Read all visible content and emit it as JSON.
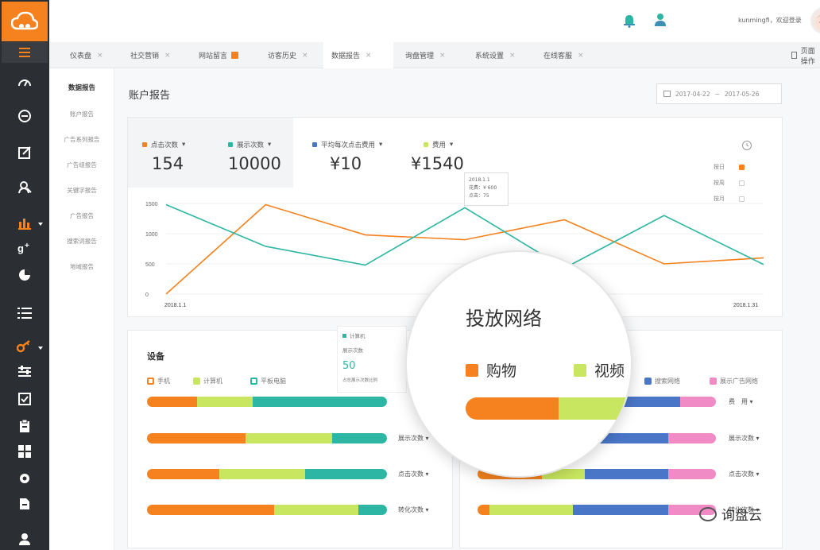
{
  "colors": {
    "orange": "#f5821f",
    "teal": "#2db6a3",
    "blue": "#4a76c8",
    "lime": "#c8e65f",
    "pink": "#f08bc6",
    "sidebar": "#2b2e33"
  },
  "topbar": {
    "user_text": "kunmingfi，欢迎登录"
  },
  "tabs": [
    {
      "label": "仪表盘",
      "close": "×"
    },
    {
      "label": "社交营销",
      "close": "×"
    },
    {
      "label": "网站留言",
      "close": ""
    },
    {
      "label": "访客历史",
      "close": "×"
    },
    {
      "label": "数据报告",
      "close": "×"
    },
    {
      "label": "询盘管理",
      "close": "×"
    },
    {
      "label": "系统设置",
      "close": "×"
    },
    {
      "label": "在线客服",
      "close": "×"
    }
  ],
  "page_op": "页面操作",
  "submenu": {
    "head": "数据报告",
    "items": [
      "账户报告",
      "广告系列报告",
      "广告组报告",
      "关键字报告",
      "广告报告",
      "搜索词报告",
      "地域报告"
    ]
  },
  "main": {
    "title": "账户报告",
    "date_start": "2017-04-22",
    "date_sep": "~",
    "date_end": "2017-05-26"
  },
  "metrics": [
    {
      "label": "点击次数",
      "value": "154",
      "color": "#f5821f"
    },
    {
      "label": "展示次数",
      "value": "10000",
      "color": "#2db6a3"
    },
    {
      "label": "平均每次点击费用",
      "value": "¥10",
      "color": "#4a76c8"
    },
    {
      "label": "费用",
      "value": "¥1540",
      "color": "#c8e65f"
    }
  ],
  "legend_right": [
    {
      "label": "按日",
      "checked": true
    },
    {
      "label": "按周",
      "checked": false
    },
    {
      "label": "按月",
      "checked": false
    }
  ],
  "tooltip": {
    "date": "2018.1.1",
    "line1": "花费：¥ 600",
    "line2": "点击：75"
  },
  "chart_data": {
    "type": "line",
    "x_start_label": "2018.1.1",
    "x_end_label": "2018.1.31",
    "y_ticks": [
      "1500",
      "1000",
      "500",
      "0"
    ],
    "ylim": [
      0,
      1500
    ],
    "series": [
      {
        "name": "点击次数",
        "color": "#f5821f",
        "values": [
          0,
          1480,
          980,
          900,
          1230,
          500,
          600
        ]
      },
      {
        "name": "展示次数",
        "color": "#2db6a3",
        "values": [
          1480,
          790,
          480,
          1430,
          430,
          1300,
          490
        ]
      }
    ]
  },
  "device_card": {
    "title": "设备",
    "legend": [
      {
        "label": "手机",
        "color": "#f5821f"
      },
      {
        "label": "计算机",
        "color": "#c8e65f"
      },
      {
        "label": "平板电脑",
        "color": "#2db6a3"
      }
    ],
    "rows": [
      {
        "label": "",
        "segments": [
          0.21,
          0.23,
          0.56
        ]
      },
      {
        "label": "展示次数",
        "segments": [
          0.41,
          0.36,
          0.23
        ]
      },
      {
        "label": "点击次数",
        "segments": [
          0.3,
          0.36,
          0.34
        ]
      },
      {
        "label": "转化次数",
        "segments": [
          0.53,
          0.35,
          0.12
        ]
      }
    ]
  },
  "mini_tip": {
    "label": "计算机",
    "sub": "展示次数",
    "value": "50",
    "note": "占总展示次数比例"
  },
  "network_card": {
    "title": "投放网络",
    "legend": [
      {
        "label": "购物",
        "color": "#f5821f"
      },
      {
        "label": "视频",
        "color": "#c8e65f"
      },
      {
        "label": "搜索网络",
        "color": "#4a76c8"
      },
      {
        "label": "展示广告网络",
        "color": "#f08bc6"
      }
    ],
    "rows": [
      {
        "label": "费　用",
        "segments": [
          0.3,
          0.25,
          0.3,
          0.15
        ]
      },
      {
        "label": "展示次数",
        "segments": [
          0.2,
          0.3,
          0.3,
          0.2
        ]
      },
      {
        "label": "点击次数",
        "segments": [
          0.27,
          0.18,
          0.35,
          0.2
        ]
      },
      {
        "label": "转化次数",
        "segments": [
          0.05,
          0.35,
          0.4,
          0.2
        ]
      }
    ]
  },
  "watermark": "询盘云"
}
